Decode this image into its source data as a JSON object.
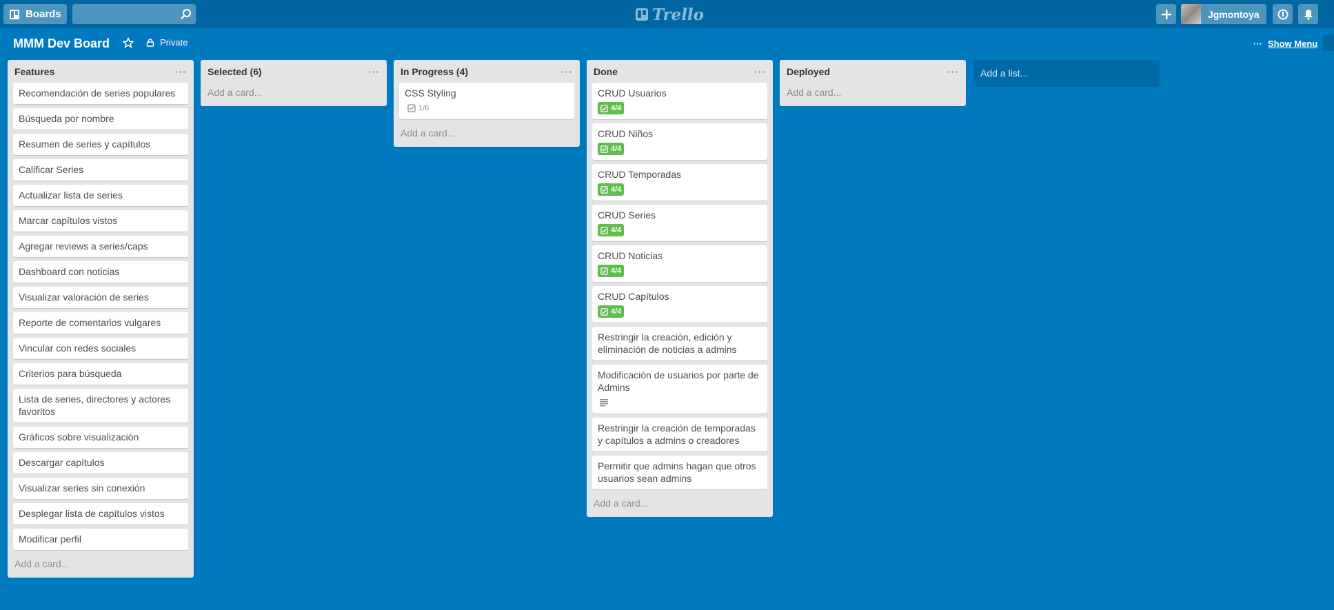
{
  "header": {
    "boards_label": "Boards",
    "logo_text": "Trello",
    "user_name": "Jgmontoya",
    "search": {
      "value": ""
    }
  },
  "board": {
    "title": "MMM Dev Board",
    "privacy": "Private",
    "show_menu": "Show Menu"
  },
  "lists": [
    {
      "title": "Features",
      "add_card": "Add a card...",
      "cards": [
        {
          "title": "Recomendación de series populares"
        },
        {
          "title": "Búsqueda por nombre"
        },
        {
          "title": "Resumen de series y capítulos"
        },
        {
          "title": "Calificar Series"
        },
        {
          "title": "Actualizar lista de series"
        },
        {
          "title": "Marcar capítulos vistos"
        },
        {
          "title": "Agregar reviews a series/caps"
        },
        {
          "title": "Dashboard con noticias"
        },
        {
          "title": "Visualizar valoración de series"
        },
        {
          "title": "Reporte de comentarios vulgares"
        },
        {
          "title": "Vincular con redes sociales"
        },
        {
          "title": "Criterios para búsqueda"
        },
        {
          "title": "Lista de series, directores y actores favoritos"
        },
        {
          "title": "Gráficos sobre visualización"
        },
        {
          "title": "Descargar capítulos"
        },
        {
          "title": "Visualizar series sin conexión"
        },
        {
          "title": "Desplegar lista de capítulos vistos"
        },
        {
          "title": "Modificar perfil"
        }
      ]
    },
    {
      "title": "Selected (6)",
      "add_card": "Add a card...",
      "cards": []
    },
    {
      "title": "In Progress (4)",
      "add_card": "Add a card...",
      "cards": [
        {
          "title": "CSS Styling",
          "checklist": "1/6",
          "checklist_complete": false
        }
      ]
    },
    {
      "title": "Done",
      "add_card": "Add a card...",
      "cards": [
        {
          "title": "CRUD Usuarios",
          "checklist": "4/4",
          "checklist_complete": true
        },
        {
          "title": "CRUD Niños",
          "checklist": "4/4",
          "checklist_complete": true
        },
        {
          "title": "CRUD Temporadas",
          "checklist": "4/4",
          "checklist_complete": true
        },
        {
          "title": "CRUD Series",
          "checklist": "4/4",
          "checklist_complete": true
        },
        {
          "title": "CRUD Noticias",
          "checklist": "4/4",
          "checklist_complete": true
        },
        {
          "title": "CRUD Capítulos",
          "checklist": "4/4",
          "checklist_complete": true
        },
        {
          "title": "Restringir la creación, edición y eliminación de noticias a admins"
        },
        {
          "title": "Modificación de usuarios por parte de Admins",
          "has_description": true
        },
        {
          "title": "Restringir la creación de temporadas y capítulos a admins o creadores"
        },
        {
          "title": "Permitir que admins hagan que otros usuarios sean admins"
        }
      ]
    },
    {
      "title": "Deployed",
      "add_card": "Add a card...",
      "cards": []
    }
  ],
  "add_list": "Add a list...",
  "colors": {
    "board_bg": "#0079bf",
    "header_bg": "#0067a3",
    "list_bg": "#e2e4e6",
    "badge_complete": "#61bd4f"
  },
  "icons": [
    "boards-icon",
    "search-icon",
    "trello-logo-icon",
    "plus-icon",
    "info-icon",
    "bell-icon",
    "star-icon",
    "lock-icon",
    "more-icon",
    "checklist-icon",
    "description-icon"
  ]
}
